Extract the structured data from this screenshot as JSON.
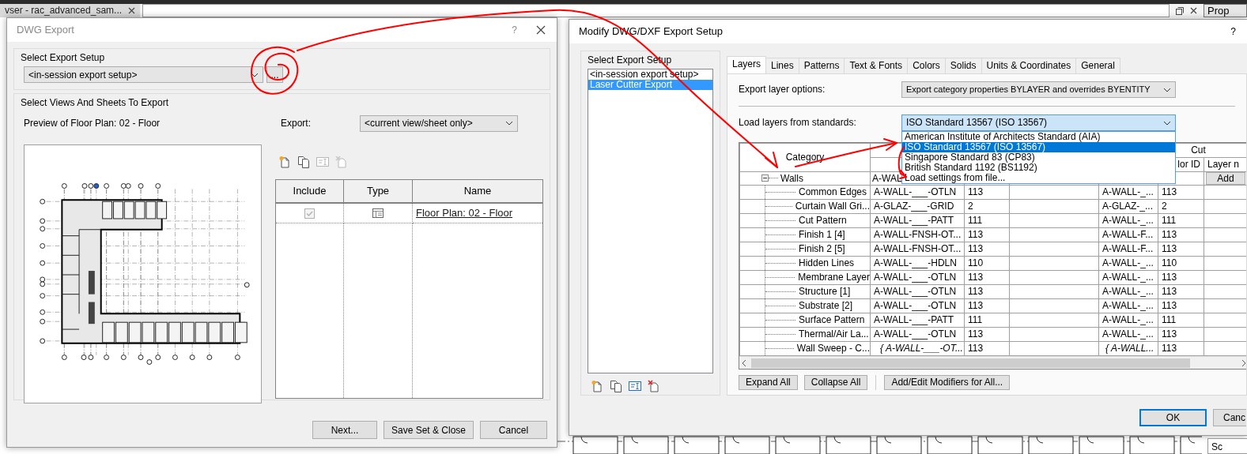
{
  "app": {
    "tab_title": "vser - rac_advanced_sam...",
    "panel_title": "Prop",
    "panel_field": "Sc"
  },
  "dwg_export": {
    "title": "DWG Export",
    "help": "?",
    "setup_group": "Select Export Setup",
    "setup_value": "<in-session export setup>",
    "browse_button": "...",
    "views_group": "Select Views And Sheets To Export",
    "preview_label": "Preview of Floor Plan: 02 - Floor",
    "export_label": "Export:",
    "export_value": "<current view/sheet only>",
    "tools": [
      {
        "kind": "new",
        "disabled": false
      },
      {
        "kind": "duplicate",
        "disabled": false
      },
      {
        "kind": "rename",
        "disabled": true
      },
      {
        "kind": "delete",
        "disabled": true
      }
    ],
    "table": {
      "columns": [
        "Include",
        "Type",
        "Name"
      ],
      "rows": [
        {
          "checked": true,
          "disabled": true,
          "name": "Floor Plan: 02 - Floor"
        }
      ]
    },
    "buttons": [
      "Next...",
      "Save Set & Close",
      "Cancel"
    ]
  },
  "modify": {
    "title": "Modify DWG/DXF Export Setup",
    "help": "?",
    "setup_group": "Select Export Setup",
    "setups": [
      {
        "label": "<in-session export setup>",
        "selected": false
      },
      {
        "label": "Laser Cutter Export",
        "selected": true
      }
    ],
    "tools": [
      {
        "kind": "new",
        "disabled": false
      },
      {
        "kind": "duplicate",
        "disabled": false
      },
      {
        "kind": "rename",
        "disabled": false
      },
      {
        "kind": "delete",
        "disabled": false
      }
    ],
    "tabs": [
      {
        "label": "Layers",
        "selected": true
      },
      {
        "label": "Lines",
        "selected": false
      },
      {
        "label": "Patterns",
        "selected": false
      },
      {
        "label": "Text & Fonts",
        "selected": false
      },
      {
        "label": "Colors",
        "selected": false
      },
      {
        "label": "Solids",
        "selected": false
      },
      {
        "label": "Units & Coordinates",
        "selected": false
      },
      {
        "label": "General",
        "selected": false
      }
    ],
    "export_layer_label": "Export layer options:",
    "export_layer_value": "Export category properties BYLAYER and overrides BYENTITY",
    "standards_label": "Load layers from standards:",
    "standards_value": "ISO Standard 13567 (ISO 13567)",
    "standards_options": [
      {
        "label": "American Institute of Architects Standard (AIA)",
        "selected": false
      },
      {
        "label": "ISO Standard 13567 (ISO 13567)",
        "selected": true
      },
      {
        "label": "Singapore Standard 83 (CP83)",
        "selected": false
      },
      {
        "label": "British Standard 1192 (BS1192)",
        "selected": false
      },
      {
        "label": "Load settings from file...",
        "selected": false
      }
    ],
    "grid": {
      "header": {
        "category": "Category",
        "cut": "Cut",
        "cut_color_id": "lor ID",
        "cut_layer_modifiers": "Layer n"
      },
      "group": {
        "label": "Walls",
        "expanded": true,
        "layer": "A-WAL",
        "action": "Add",
        "children": [
          {
            "name": "Common Edges",
            "layer": "A-WALL-___-OTLN",
            "color_id": "113",
            "cut_layer": "A-WALL-_...",
            "cut_color_id": "113",
            "italic": false
          },
          {
            "name": "Curtain Wall Gri...",
            "layer": "A-GLAZ-___-GRID",
            "color_id": "2",
            "cut_layer": "A-GLAZ-_...",
            "cut_color_id": "2",
            "italic": false
          },
          {
            "name": "Cut Pattern",
            "layer": "A-WALL-___-PATT",
            "color_id": "111",
            "cut_layer": "A-WALL-_...",
            "cut_color_id": "111",
            "italic": false
          },
          {
            "name": "Finish 1 [4]",
            "layer": "A-WALL-FNSH-OT...",
            "color_id": "113",
            "cut_layer": "A-WALL-F...",
            "cut_color_id": "113",
            "italic": false
          },
          {
            "name": "Finish 2 [5]",
            "layer": "A-WALL-FNSH-OT...",
            "color_id": "113",
            "cut_layer": "A-WALL-F...",
            "cut_color_id": "113",
            "italic": false
          },
          {
            "name": "Hidden Lines",
            "layer": "A-WALL-___-HDLN",
            "color_id": "110",
            "cut_layer": "A-WALL-_...",
            "cut_color_id": "110",
            "italic": false
          },
          {
            "name": "Membrane Layer",
            "layer": "A-WALL-___-OTLN",
            "color_id": "113",
            "cut_layer": "A-WALL-_...",
            "cut_color_id": "113",
            "italic": false
          },
          {
            "name": "Structure [1]",
            "layer": "A-WALL-___-OTLN",
            "color_id": "113",
            "cut_layer": "A-WALL-_...",
            "cut_color_id": "113",
            "italic": false
          },
          {
            "name": "Substrate [2]",
            "layer": "A-WALL-___-OTLN",
            "color_id": "113",
            "cut_layer": "A-WALL-_...",
            "cut_color_id": "113",
            "italic": false
          },
          {
            "name": "Surface Pattern",
            "layer": "A-WALL-___-PATT",
            "color_id": "111",
            "cut_layer": "A-WALL-_...",
            "cut_color_id": "111",
            "italic": false
          },
          {
            "name": "Thermal/Air La...",
            "layer": "A-WALL-___-OTLN",
            "color_id": "113",
            "cut_layer": "A-WALL-_...",
            "cut_color_id": "113",
            "italic": false
          },
          {
            "name": "Wall Sweep - C...",
            "layer": "{ A-WALL-___-OT...",
            "color_id": "113",
            "cut_layer": "{ A-WALL...",
            "cut_color_id": "113",
            "italic": true
          }
        ]
      }
    },
    "grid_buttons": [
      "Expand All",
      "Collapse All",
      "Add/Edit Modifiers for All..."
    ],
    "footer_buttons": [
      {
        "label": "OK",
        "default": true
      },
      {
        "label": "Canc",
        "default": false
      }
    ]
  }
}
